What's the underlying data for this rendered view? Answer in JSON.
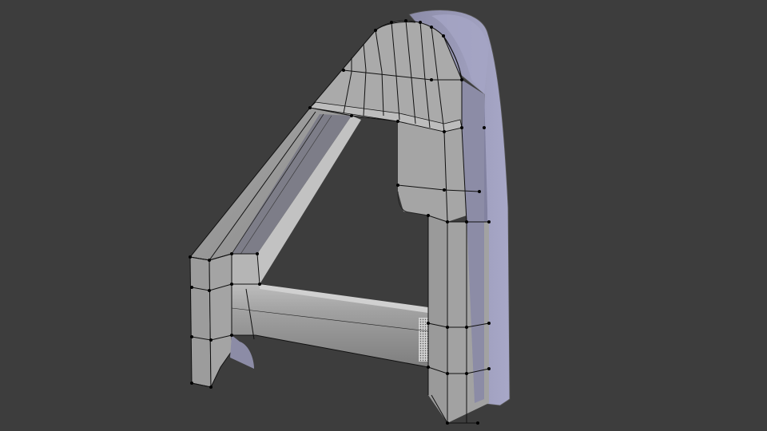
{
  "viewport": {
    "name": "3d-viewport",
    "background": "#3d3d3d",
    "object": "wireframe-bracket-mesh"
  },
  "colors": {
    "face_front": "#9a9a9a",
    "face_light": "#b4b4b4",
    "face_inner": "#888888",
    "face_dark": "#6e6e6e",
    "side_lavender": "#9898b4",
    "side_lavender_dark": "#7a7a94",
    "edge": "#111111",
    "vertex": "#000000"
  }
}
